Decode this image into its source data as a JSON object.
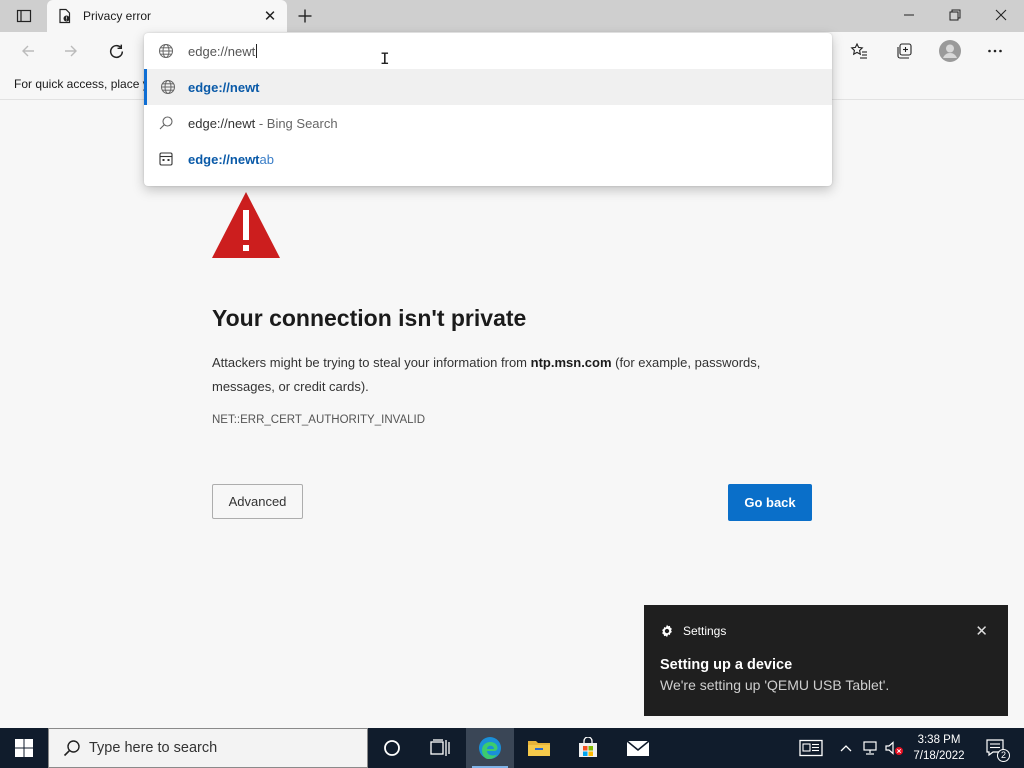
{
  "tab": {
    "title": "Privacy error"
  },
  "favorites_bar": {
    "hint": "For quick access, place your favorites here on the favorites bar."
  },
  "omnibox": {
    "value": "edge://newt",
    "suggestions": [
      {
        "type": "url",
        "icon": "globe-icon",
        "bold": "edge://newt",
        "rest": ""
      },
      {
        "type": "search",
        "icon": "search-icon",
        "text": "edge://newt",
        "suffix": " - Bing Search"
      },
      {
        "type": "page",
        "icon": "newtab-icon",
        "bold": "edge://newt",
        "rest": "ab"
      }
    ]
  },
  "error_page": {
    "title": "Your connection isn't private",
    "desc_before": "Attackers might be trying to steal your information from ",
    "desc_host": "ntp.msn.com",
    "desc_after": " (for example, passwords, messages, or credit cards).",
    "error_code": "NET::ERR_CERT_AUTHORITY_INVALID",
    "advanced_label": "Advanced",
    "go_back_label": "Go back"
  },
  "toast": {
    "app_name": "Settings",
    "title": "Setting up a device",
    "body": "We're setting up 'QEMU USB Tablet'."
  },
  "taskbar": {
    "search_placeholder": "Type here to search",
    "time": "3:38 PM",
    "date": "7/18/2022",
    "notification_count": "2"
  },
  "colors": {
    "accent": "#0a6fc9",
    "warning_red": "#cc1e1e",
    "taskbar": "#101c2c",
    "toast_bg": "#1f1f1f"
  }
}
